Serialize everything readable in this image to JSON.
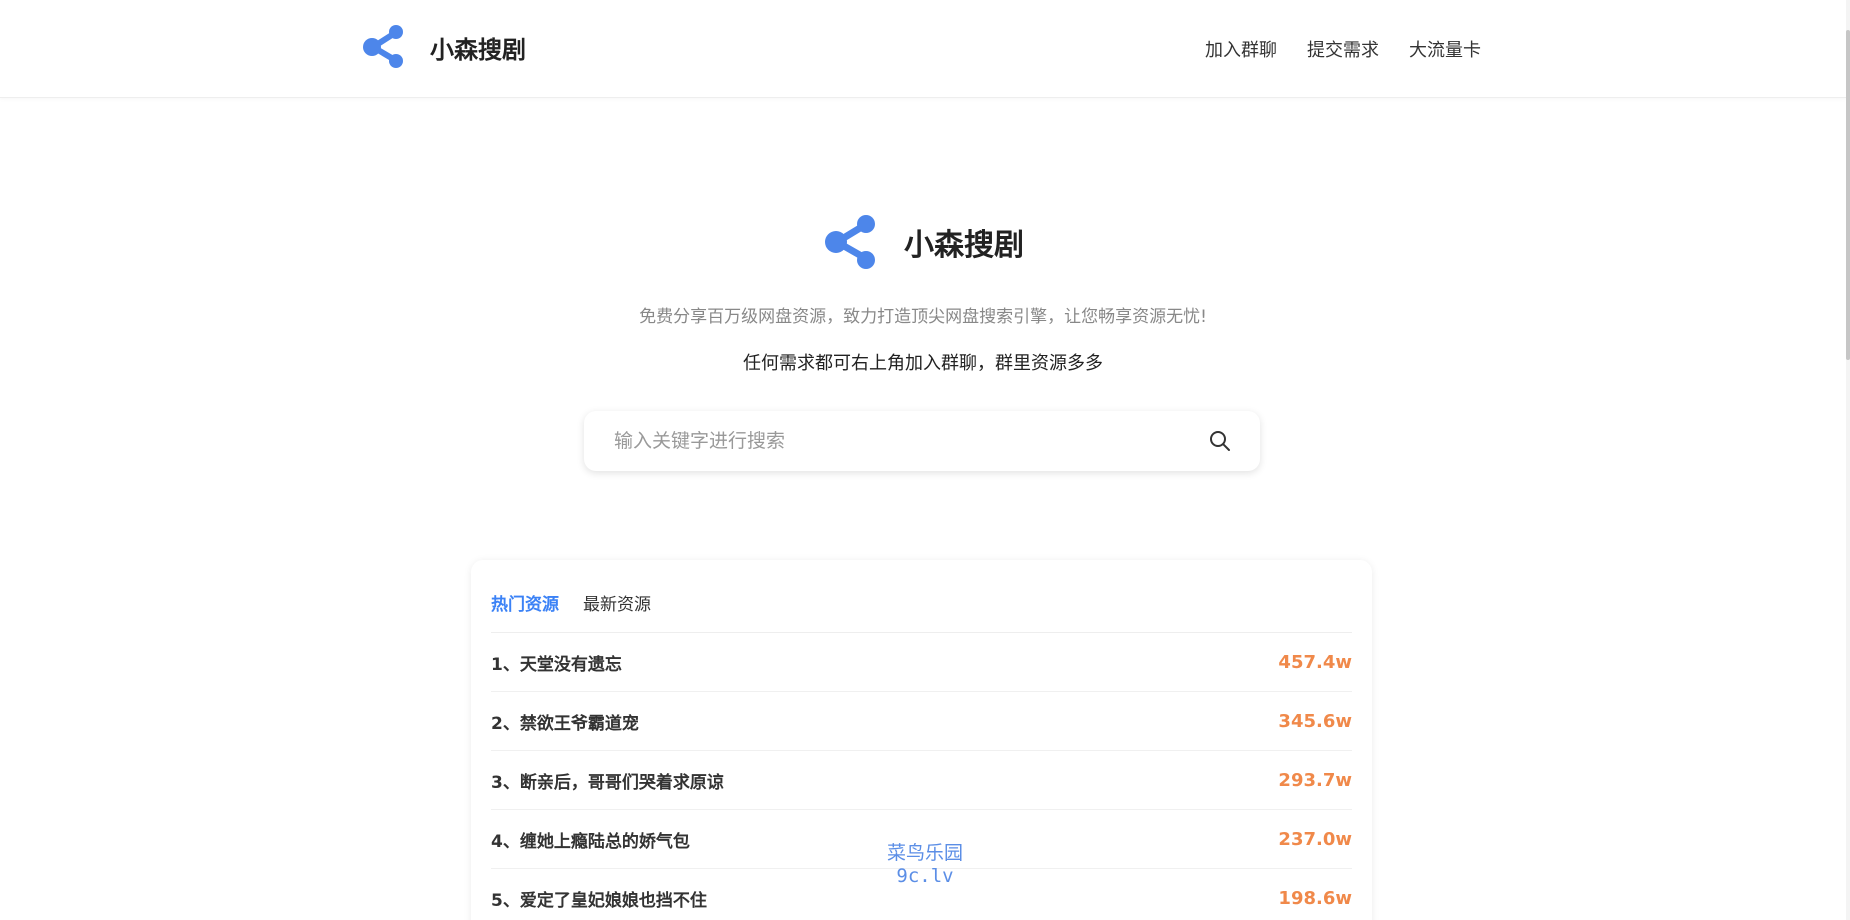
{
  "header": {
    "brand_title": "小森搜剧",
    "logo_icon": "share-icon",
    "nav": [
      {
        "label": "加入群聊"
      },
      {
        "label": "提交需求"
      },
      {
        "label": "大流量卡"
      }
    ]
  },
  "hero": {
    "brand_title": "小森搜剧",
    "subtitle": "免费分享百万级网盘资源，致力打造顶尖网盘搜索引擎，让您畅享资源无忧!",
    "tip": "任何需求都可右上角加入群聊，群里资源多多"
  },
  "search": {
    "placeholder": "输入关键字进行搜索",
    "value": "",
    "icon": "search-icon"
  },
  "tabs": [
    {
      "label": "热门资源",
      "active": true
    },
    {
      "label": "最新资源",
      "active": false
    }
  ],
  "resources": [
    {
      "name": "1、天堂没有遗忘",
      "count": "457.4w"
    },
    {
      "name": "2、禁欲王爷霸道宠",
      "count": "345.6w"
    },
    {
      "name": "3、断亲后，哥哥们哭着求原谅",
      "count": "293.7w"
    },
    {
      "name": "4、缠她上瘾陆总的娇气包",
      "count": "237.0w"
    },
    {
      "name": "5、爱定了皇妃娘娘也挡不住",
      "count": "198.6w"
    }
  ],
  "watermark": {
    "line1": "菜鸟乐园",
    "line2": "9c.lv"
  },
  "colors": {
    "accent": "#3b82f6",
    "count": "#f0894a",
    "muted": "#888888"
  }
}
